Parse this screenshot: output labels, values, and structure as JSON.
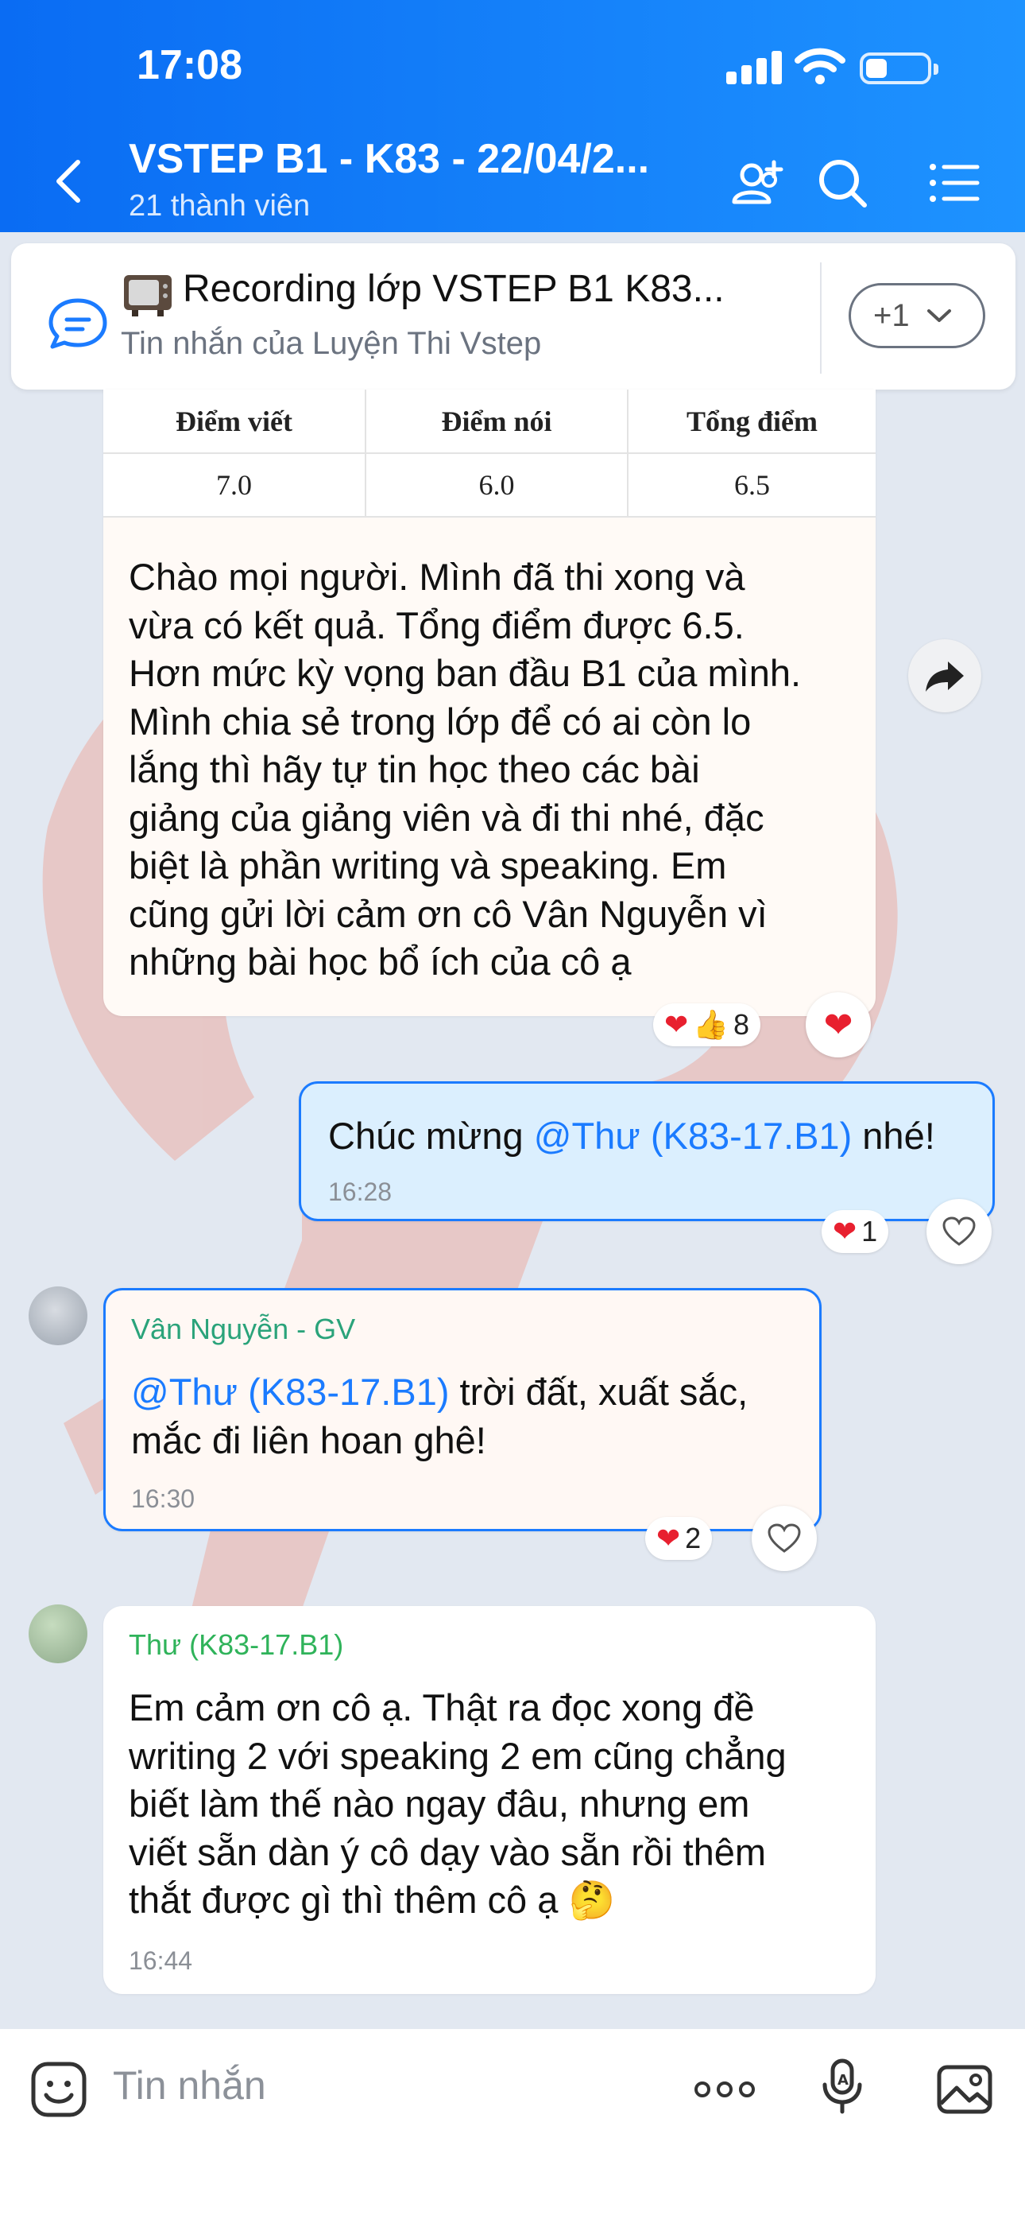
{
  "status_bar": {
    "time": "17:08"
  },
  "header": {
    "title": "VSTEP B1 - K83 - 22/04/2...",
    "subtitle": "21 thành viên",
    "icons": [
      "back-chevron-icon",
      "add-member-icon",
      "search-icon",
      "menu-list-icon"
    ]
  },
  "pinned": {
    "title": "Recording lớp VSTEP B1 K83...",
    "subtitle": "Tin nhắn của Luyện Thi Vstep",
    "more_label": "+1"
  },
  "messages": [
    {
      "table": {
        "headers": [
          "Điểm viết",
          "Điểm nói",
          "Tổng điểm"
        ],
        "values": [
          "7.0",
          "6.0",
          "6.5"
        ]
      },
      "text": "Chào mọi người. Mình đã thi xong và\nvừa có kết quả. Tổng điểm được 6.5.\nHơn mức kỳ vọng ban đầu B1 của mình.\nMình chia sẻ trong lớp để có ai còn lo\nlắng thì hãy tự tin học theo các bài\ngiảng của giảng viên và đi thi nhé, đặc\nbiệt là phần writing và speaking. Em\ncũng gửi lời cảm ơn cô Vân Nguyễn vì\nnhững bài học bổ ích của cô ạ",
      "reaction_count": "8"
    },
    {
      "prefix": "Chúc mừng ",
      "mention": "@Thư (K83-17.B1)",
      "suffix": " nhé!",
      "time": "16:28",
      "reaction_count": "1"
    },
    {
      "sender": "Vân Nguyễn - GV",
      "mention": "@Thư (K83-17.B1)",
      "text_line1_rest": " trời đất, xuất sắc,",
      "text_line2": "mắc đi liên hoan ghê!",
      "time": "16:30",
      "reaction_count": "2"
    },
    {
      "sender": "Thư (K83-17.B1)",
      "text": "Em cảm ơn cô ạ. Thật ra đọc xong đề\nwriting 2 với speaking 2 em cũng chẳng\nbiết làm thế nào ngay đâu, nhưng em\nviết sẵn dàn ý cô dạy vào sẵn rồi thêm\nthắt được gì thì thêm cô ạ",
      "emoji": "🤔",
      "time": "16:44"
    }
  ],
  "composer": {
    "placeholder": "Tin nhắn",
    "icons": [
      "sticker-icon",
      "more-dots-icon",
      "voice-to-text-icon",
      "image-icon"
    ]
  },
  "colors": {
    "header_blue": "#0a6cf3",
    "mention_blue": "#1b7bff",
    "teacher_name": "#2aa37a",
    "student_name": "#2fb35a"
  }
}
